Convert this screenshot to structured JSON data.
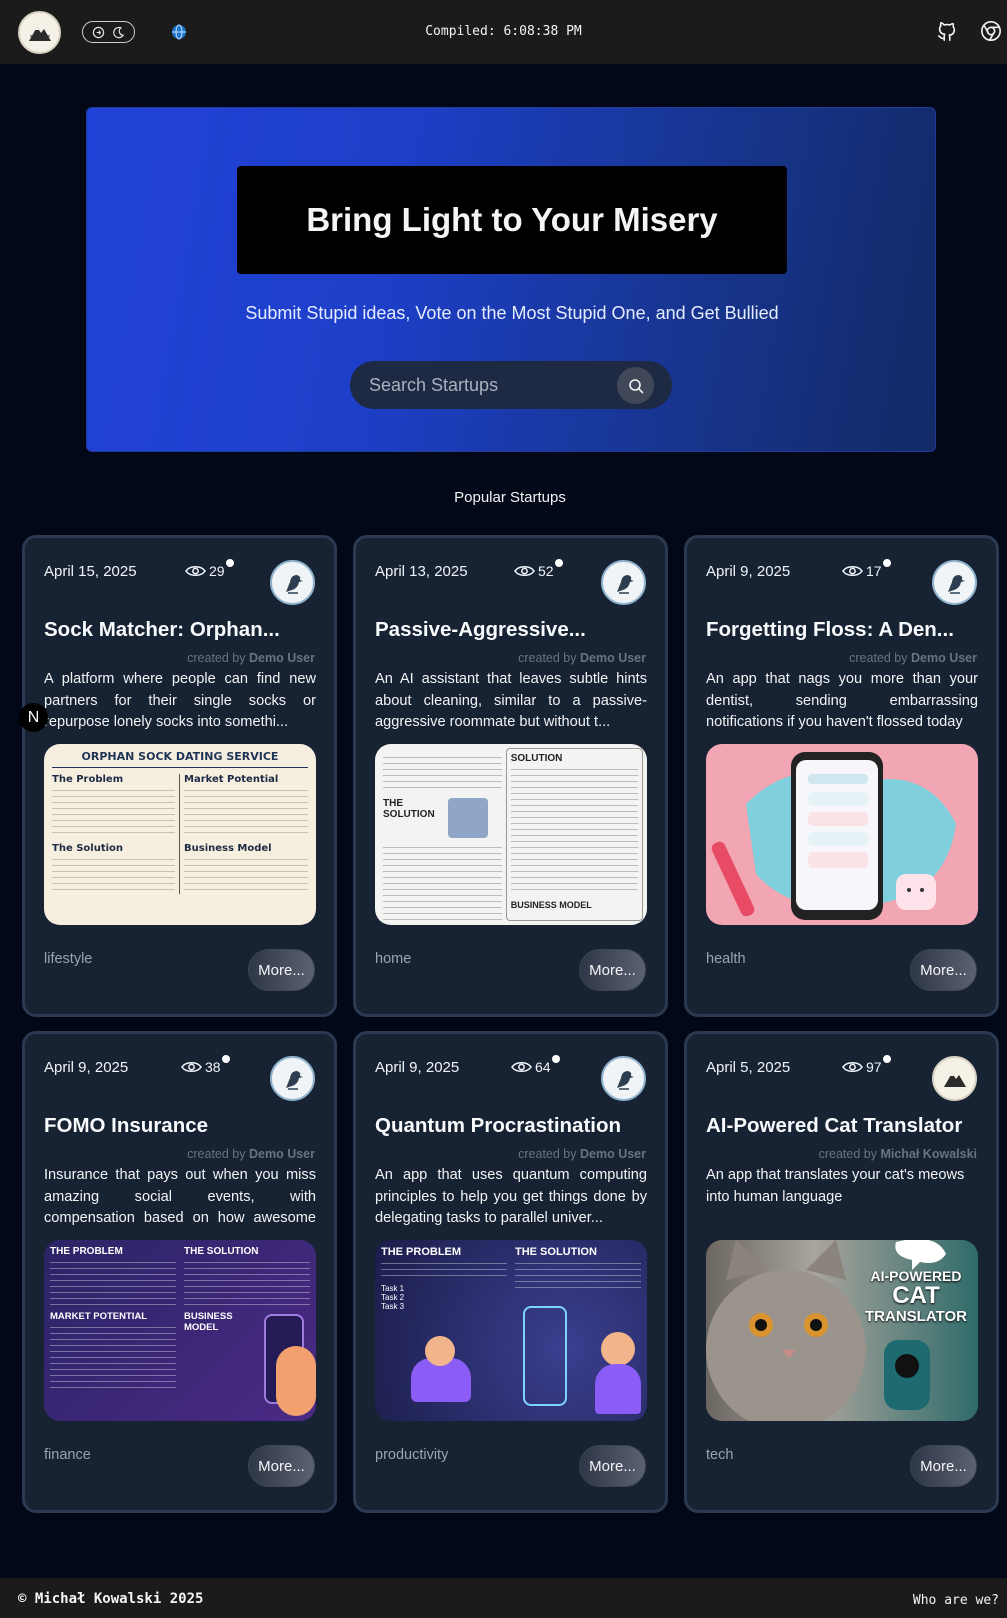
{
  "header": {
    "compiled_label": "Compiled: 6:08:38 PM"
  },
  "hero": {
    "title": "Bring Light to Your Misery",
    "subtitle": "Submit Stupid ideas, Vote on the Most Stupid One, and Get Bullied",
    "search_placeholder": "Search Startups"
  },
  "section_title": "Popular Startups",
  "badge": "N",
  "cards": [
    {
      "date": "April 15, 2025",
      "views": "29",
      "title": "Sock Matcher: Orphan...",
      "created_by": "created by",
      "creator": "Demo User",
      "desc": "A platform where people can find new partners for their single socks or repurpose lonely socks into somethi...",
      "tag": "lifestyle",
      "more": "More...",
      "thumb": {
        "heading": "ORPHAN SOCK DATING SERVICE",
        "h1": "The Problem",
        "h2": "Market Potential",
        "h3": "The Solution",
        "h4": "Business Model"
      }
    },
    {
      "date": "April 13, 2025",
      "views": "52",
      "title": "Passive-Aggressive...",
      "created_by": "created by",
      "creator": "Demo User",
      "desc": "An AI assistant that leaves subtle hints about cleaning, similar to a passive-aggressive roommate but without t...",
      "tag": "home",
      "more": "More...",
      "thumb": {
        "h1": "THE SOLUTION",
        "h2": "SOLUTION",
        "h3": "BUSINESS MODEL"
      }
    },
    {
      "date": "April 9, 2025",
      "views": "17",
      "title": "Forgetting Floss: A Den...",
      "created_by": "created by",
      "creator": "Demo User",
      "desc": "An app that nags you more than your dentist, sending embarrassing notifications if you haven't flossed today",
      "tag": "health",
      "more": "More..."
    },
    {
      "date": "April 9, 2025",
      "views": "38",
      "title": "FOMO Insurance",
      "created_by": "created by",
      "creator": "Demo User",
      "desc": "Insurance that pays out when you miss amazing social events, with compensation based on how awesome the ev...",
      "tag": "finance",
      "more": "More...",
      "thumb": {
        "h1": "THE PROBLEM",
        "h2": "THE SOLUTION",
        "h3": "MARKET POTENTIAL",
        "h4": "BUSINESS MODEL"
      }
    },
    {
      "date": "April 9, 2025",
      "views": "64",
      "title": "Quantum Procrastination",
      "created_by": "created by",
      "creator": "Demo User",
      "desc": "An app that uses quantum computing principles to help you get things done by delegating tasks to parallel univer...",
      "tag": "productivity",
      "more": "More...",
      "thumb": {
        "h1": "THE PROBLEM",
        "h2": "THE SOLUTION",
        "t1": "Task 1",
        "t2": "Task 2",
        "t3": "Task 3"
      }
    },
    {
      "date": "April 5, 2025",
      "views": "97",
      "title": "AI-Powered Cat Translator",
      "created_by": "created by",
      "creator": "Michał Kowalski",
      "desc": "An app that translates your cat's meows into human language",
      "tag": "tech",
      "more": "More...",
      "thumb": {
        "l1": "AI-POWERED",
        "l2": "CAT",
        "l3": "TRANSLATOR"
      }
    }
  ],
  "footer": {
    "copyright": "© Michał Kowalski 2025",
    "who": "Who are we?"
  },
  "colors": {
    "background": "#020817",
    "card": "#172233",
    "hero_start": "#2142d6",
    "hero_end": "#132a66"
  }
}
